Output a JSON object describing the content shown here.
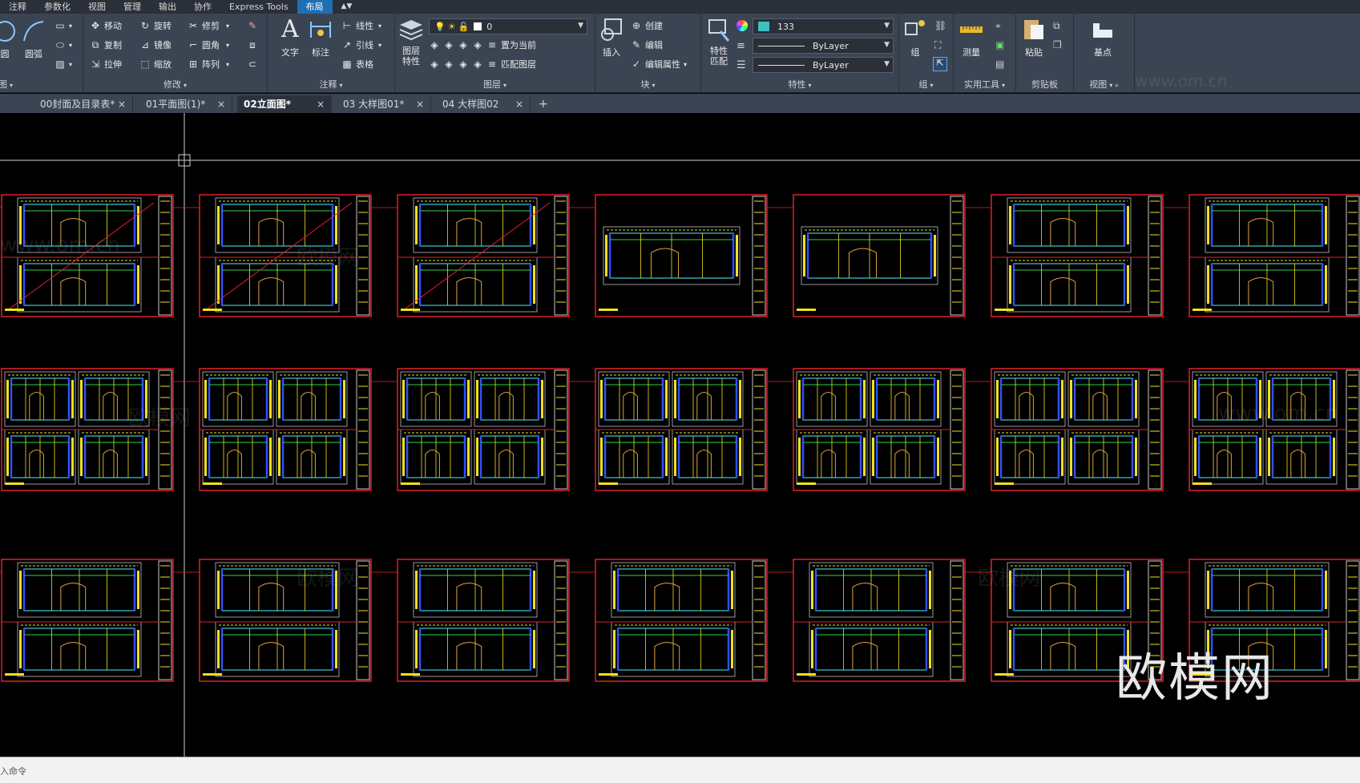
{
  "menubar": {
    "items": [
      "注释",
      "参数化",
      "视图",
      "管理",
      "输出",
      "协作",
      "Express Tools",
      "布局"
    ],
    "active_index": 7,
    "extra_label": "▲▼"
  },
  "ribbon": {
    "panels": {
      "draw": {
        "title": "图",
        "arc_label": "圆弧",
        "circle_label": "圆"
      },
      "modify": {
        "title": "修改",
        "move": "移动",
        "rotate": "旋转",
        "trim": "修剪",
        "copy": "复制",
        "mirror": "镜像",
        "fillet": "圆角",
        "stretch": "拉伸",
        "scale": "缩放",
        "array": "阵列"
      },
      "annotation": {
        "title": "注释",
        "text": "文字",
        "dimension": "标注",
        "linear": "线性",
        "leader": "引线",
        "table": "表格"
      },
      "layers": {
        "title": "图层",
        "layer_props": "图层\n特性",
        "current_layer": "0",
        "set_current": "置为当前",
        "match_layer": "匹配图层"
      },
      "block": {
        "title": "块",
        "insert": "插入",
        "create": "创建",
        "edit": "编辑",
        "edit_attr": "编辑属性"
      },
      "properties": {
        "title": "特性",
        "match": "特性\n匹配",
        "color_value": "133",
        "color_swatch": "#3fbfbf",
        "linetype": "ByLayer",
        "lineweight": "ByLayer"
      },
      "groups": {
        "title": "组",
        "group": "组"
      },
      "utilities": {
        "title": "实用工具",
        "measure": "测量"
      },
      "clipboard": {
        "title": "剪贴板",
        "paste": "粘贴"
      },
      "view": {
        "title": "视图",
        "base": "基点"
      }
    },
    "watermark": "www.om.cn"
  },
  "tabs": [
    {
      "label": "00封面及目录表*",
      "active": false
    },
    {
      "label": "01平面图(1)*",
      "active": false
    },
    {
      "label": "02立面图*",
      "active": true
    },
    {
      "label": "03 大样图01*",
      "active": false
    },
    {
      "label": "04 大样图02",
      "active": false
    }
  ],
  "tab_close": "×",
  "tab_add": "+",
  "canvas": {
    "watermark_big": "欧模网",
    "watermark_small": "欧模网",
    "watermark_url": "www.om.cn",
    "sheet_rows": 3,
    "sheet_cols": 7,
    "colors": {
      "frame": "#e0202a",
      "yellow": "#f0e020",
      "cyan": "#40c8d8",
      "blue": "#3050ff",
      "green": "#30d040",
      "white": "#ffffff"
    }
  },
  "command_line": {
    "prompt": "入命令"
  }
}
